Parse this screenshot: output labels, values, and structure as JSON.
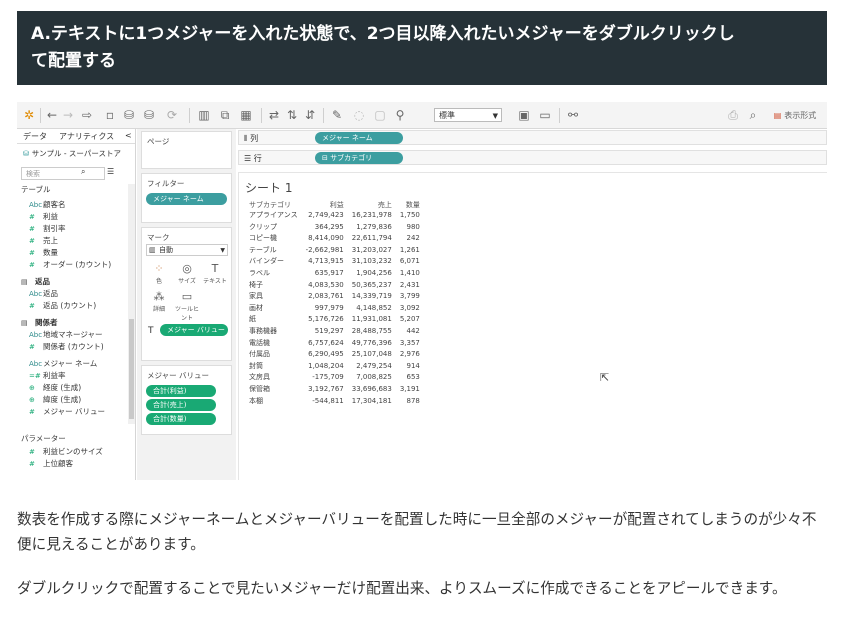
{
  "heading": {
    "line1": "A.テキストに1つメジャーを入れた状態で、2つ目以降入れたいメジャーをダブルクリックし",
    "line2": "て配置する"
  },
  "toolbar": {
    "mark_type_combo": "標準",
    "show_me_label": "表示形式"
  },
  "left_pane": {
    "tab_data": "データ",
    "tab_analytics": "アナリティクス",
    "collapse_glyph": "<",
    "data_source": "サンプル - スーパーストア",
    "search_placeholder": "検索",
    "items": [
      {
        "type": "hdr",
        "label": "テーブル"
      },
      {
        "type": "abc",
        "icon": "Abc",
        "label": "顧客名"
      },
      {
        "type": "num",
        "icon": "#",
        "label": "利益"
      },
      {
        "type": "num",
        "icon": "#",
        "label": "割引率"
      },
      {
        "type": "num",
        "icon": "#",
        "label": "売上"
      },
      {
        "type": "num",
        "icon": "#",
        "label": "数量"
      },
      {
        "type": "num",
        "icon": "#",
        "label": "オーダー (カウント)"
      },
      {
        "type": "group",
        "icon": "▤",
        "label": "返品"
      },
      {
        "type": "abc",
        "icon": "Abc",
        "label": "返品"
      },
      {
        "type": "num",
        "icon": "#",
        "label": "返品 (カウント)"
      },
      {
        "type": "group",
        "icon": "▤",
        "label": "関係者"
      },
      {
        "type": "abc",
        "icon": "Abc",
        "label": "地域マネージャー"
      },
      {
        "type": "num",
        "icon": "#",
        "label": "関係者 (カウント)"
      },
      {
        "type": "abc",
        "icon": "Abc",
        "label": "メジャー ネーム"
      },
      {
        "type": "num",
        "icon": "=#",
        "label": "利益率"
      },
      {
        "type": "geo",
        "icon": "⊕",
        "label": "経度 (生成)"
      },
      {
        "type": "geo",
        "icon": "⊕",
        "label": "緯度 (生成)"
      },
      {
        "type": "num",
        "icon": "#",
        "label": "メジャー バリュー"
      },
      {
        "type": "hdr",
        "label": "パラメーター"
      },
      {
        "type": "num",
        "icon": "#",
        "label": "利益ビンのサイズ"
      },
      {
        "type": "num",
        "icon": "#",
        "label": "上位顧客"
      }
    ]
  },
  "mid_pane": {
    "pages": "ページ",
    "filters": "フィルター",
    "filter_pill": "メジャー ネーム",
    "marks": "マーク",
    "marks_combo": "自動",
    "mark_buttons": [
      "色",
      "サイズ",
      "テキスト",
      "詳細",
      "ツールヒント"
    ],
    "marks_pill": "メジャー バリュー",
    "measure_values": "メジャー バリュー",
    "mv_pills": [
      "合計(利益)",
      "合計(売上)",
      "合計(数量)"
    ]
  },
  "shelves": {
    "columns_label": "列",
    "columns_pill": "メジャー ネーム",
    "rows_label": "行",
    "rows_pill": "サブカテゴリ"
  },
  "sheet": {
    "title": "シート 1",
    "table": {
      "headers": [
        "サブカテゴリ",
        "利益",
        "売上",
        "数量"
      ],
      "rows": [
        [
          "アプライアンス",
          "2,749,423",
          "16,231,978",
          "1,750"
        ],
        [
          "クリップ",
          "364,295",
          "1,279,836",
          "980"
        ],
        [
          "コピー機",
          "8,414,090",
          "22,611,794",
          "242"
        ],
        [
          "テーブル",
          "-2,662,981",
          "31,203,027",
          "1,261"
        ],
        [
          "バインダー",
          "4,713,915",
          "31,103,232",
          "6,071"
        ],
        [
          "ラベル",
          "635,917",
          "1,904,256",
          "1,410"
        ],
        [
          "椅子",
          "4,083,530",
          "50,365,237",
          "2,431"
        ],
        [
          "家具",
          "2,083,761",
          "14,339,719",
          "3,799"
        ],
        [
          "画材",
          "997,979",
          "4,148,852",
          "3,092"
        ],
        [
          "紙",
          "5,176,726",
          "11,931,081",
          "5,207"
        ],
        [
          "事務機器",
          "519,297",
          "28,488,755",
          "442"
        ],
        [
          "電話機",
          "6,757,624",
          "49,776,396",
          "3,357"
        ],
        [
          "付属品",
          "6,290,495",
          "25,107,048",
          "2,976"
        ],
        [
          "封筒",
          "1,048,204",
          "2,479,254",
          "914"
        ],
        [
          "文房具",
          "-175,709",
          "7,008,825",
          "653"
        ],
        [
          "保管箱",
          "3,192,767",
          "33,696,683",
          "3,191"
        ],
        [
          "本棚",
          "-544,811",
          "17,304,181",
          "878"
        ]
      ]
    }
  },
  "paragraphs": [
    "数表を作成する際にメジャーネームとメジャーバリューを配置した時に一旦全部のメジャーが配置されてしまうのが少々不便に見えることがあります。",
    "ダブルクリックで配置することで見たいメジャーだけ配置出来、よりスムーズに作成できることをアピールできます。"
  ]
}
